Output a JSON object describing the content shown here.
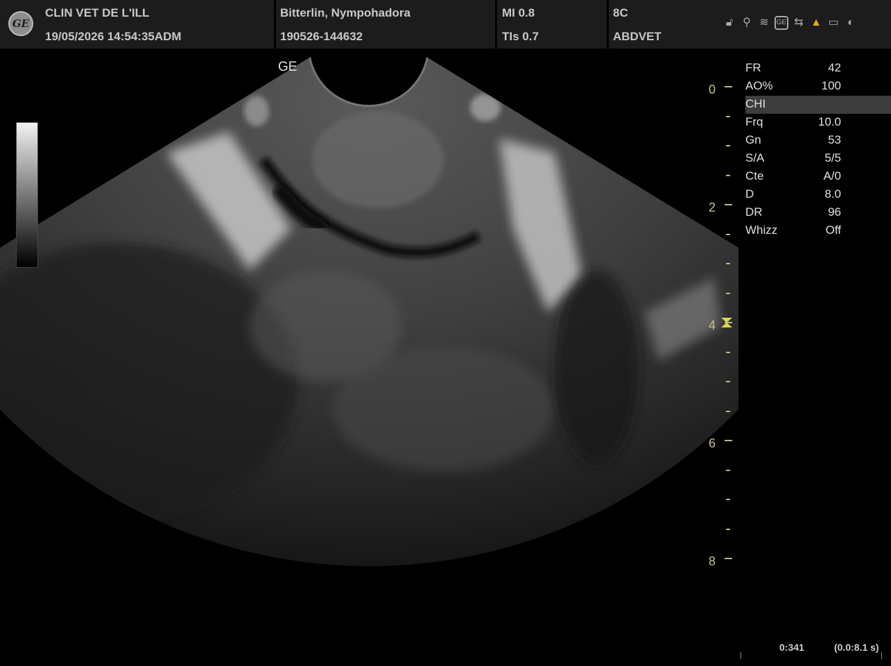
{
  "header": {
    "clinic": "CLIN VET DE L'ILL",
    "datetime": "19/05/2026 14:54:35ADM",
    "patient_name": "Bitterlin, Nympohadora",
    "patient_id": "190526-144632",
    "mi": "MI 0.8",
    "tis": "TIs 0.7",
    "probe": "8C",
    "preset": "ABDVET",
    "logo_text": "GE",
    "status_icons": [
      "lock-icon",
      "usb-disconnected-icon",
      "wifi-icon",
      "ge-network-icon",
      "usb-icon",
      "warning-icon",
      "battery-icon",
      "contrast-icon"
    ]
  },
  "image": {
    "orientation_label": "GE",
    "depth_labels": [
      "0",
      "2",
      "4",
      "6",
      "8"
    ]
  },
  "params": [
    {
      "k": "FR",
      "v": "42"
    },
    {
      "k": "AO%",
      "v": "100"
    },
    {
      "k": "CHI",
      "v": ""
    },
    {
      "k": "Frq",
      "v": "10.0"
    },
    {
      "k": "Gn",
      "v": "53"
    },
    {
      "k": "S/A",
      "v": "5/5"
    },
    {
      "k": "Cte",
      "v": "A/0"
    },
    {
      "k": "D",
      "v": "8.0"
    },
    {
      "k": "DR",
      "v": "96"
    },
    {
      "k": "Whizz",
      "v": "Off"
    }
  ],
  "footer": {
    "frame": "0:341",
    "cine_range": "(0.0:8.1 s)"
  },
  "colors": {
    "depth_scale": "#c7c08e",
    "focus_marker": "#e0d84a",
    "warning": "#d9b400"
  }
}
